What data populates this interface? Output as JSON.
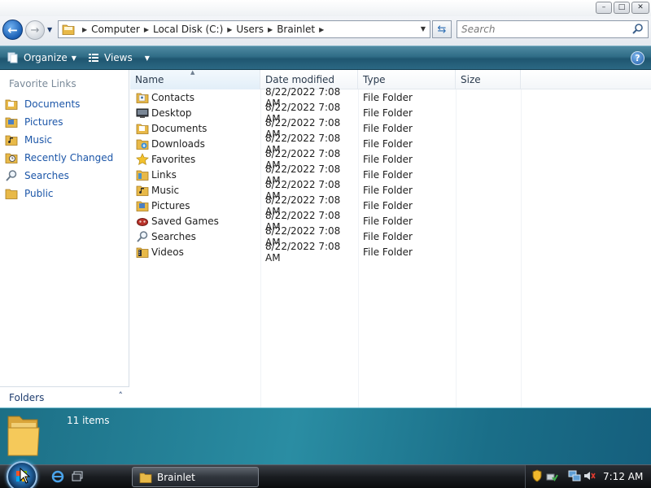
{
  "window": {
    "min_glyph": "–",
    "max_glyph": "□",
    "close_glyph": "✕"
  },
  "address": {
    "breadcrumbs": [
      "Computer",
      "Local Disk (C:)",
      "Users",
      "Brainlet"
    ],
    "search_placeholder": "Search"
  },
  "toolbar": {
    "organize_label": "Organize",
    "views_label": "Views",
    "help_label": "?"
  },
  "nav": {
    "heading": "Favorite Links",
    "items": [
      {
        "label": "Documents",
        "icon": "documents-folder-icon"
      },
      {
        "label": "Pictures",
        "icon": "pictures-folder-icon"
      },
      {
        "label": "Music",
        "icon": "music-folder-icon"
      },
      {
        "label": "Recently Changed",
        "icon": "recent-folder-icon"
      },
      {
        "label": "Searches",
        "icon": "search-icon"
      },
      {
        "label": "Public",
        "icon": "folder-icon"
      }
    ],
    "folders_label": "Folders",
    "folders_chevron": "˄"
  },
  "columns": {
    "name": "Name",
    "date": "Date modified",
    "type": "Type",
    "size": "Size"
  },
  "files": [
    {
      "name": "Contacts",
      "date": "8/22/2022 7:08 AM",
      "type": "File Folder",
      "icon": "contacts-icon"
    },
    {
      "name": "Desktop",
      "date": "8/22/2022 7:08 AM",
      "type": "File Folder",
      "icon": "desktop-icon"
    },
    {
      "name": "Documents",
      "date": "8/22/2022 7:08 AM",
      "type": "File Folder",
      "icon": "documents-folder-icon"
    },
    {
      "name": "Downloads",
      "date": "8/22/2022 7:08 AM",
      "type": "File Folder",
      "icon": "downloads-folder-icon"
    },
    {
      "name": "Favorites",
      "date": "8/22/2022 7:08 AM",
      "type": "File Folder",
      "icon": "favorites-star-icon"
    },
    {
      "name": "Links",
      "date": "8/22/2022 7:08 AM",
      "type": "File Folder",
      "icon": "links-folder-icon"
    },
    {
      "name": "Music",
      "date": "8/22/2022 7:08 AM",
      "type": "File Folder",
      "icon": "music-folder-icon"
    },
    {
      "name": "Pictures",
      "date": "8/22/2022 7:08 AM",
      "type": "File Folder",
      "icon": "pictures-folder-icon"
    },
    {
      "name": "Saved Games",
      "date": "8/22/2022 7:08 AM",
      "type": "File Folder",
      "icon": "saved-games-icon"
    },
    {
      "name": "Searches",
      "date": "8/22/2022 7:08 AM",
      "type": "File Folder",
      "icon": "search-icon"
    },
    {
      "name": "Videos",
      "date": "8/22/2022 7:08 AM",
      "type": "File Folder",
      "icon": "videos-folder-icon"
    }
  ],
  "details": {
    "item_count": "11 items"
  },
  "taskbar": {
    "window_button_label": "Brainlet",
    "clock": "7:12 AM"
  },
  "colors": {
    "link_blue": "#1c56a8",
    "command_bar": "#2f6c86",
    "details_pane": "#2a8da3",
    "folder_yellow": "#e8b948"
  }
}
